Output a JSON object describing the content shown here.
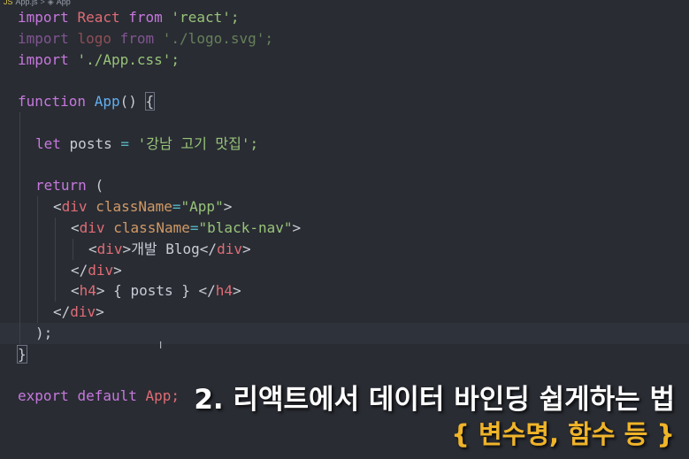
{
  "breadcrumb": {
    "file_icon": "js-file-icon",
    "file": "App.js",
    "separator": ">",
    "symbol_icon": "component-icon",
    "symbol": "App"
  },
  "code": {
    "l1": {
      "kw1": "import",
      "id": "React",
      "kw2": "from",
      "str": "'react';"
    },
    "l2": {
      "kw1": "import",
      "id": "logo",
      "kw2": "from",
      "str": "'./logo.svg';"
    },
    "l3": {
      "kw1": "import",
      "str": "'./App.css';"
    },
    "l5": {
      "kw": "function",
      "fn": "App",
      "paren": "()",
      "brace": "{"
    },
    "l7": {
      "kw": "let",
      "id": "posts",
      "op": "=",
      "str": "'강남 고기 맛집';"
    },
    "l9": {
      "kw": "return",
      "paren": "("
    },
    "l10": {
      "open": "<",
      "tag": "div",
      "attr": "className",
      "eq": "=",
      "str": "\"App\"",
      "close": ">"
    },
    "l11": {
      "open": "<",
      "tag": "div",
      "attr": "className",
      "eq": "=",
      "str": "\"black-nav\"",
      "close": ">"
    },
    "l12": {
      "open": "<",
      "tag": "div",
      "close": ">",
      "text": "개발 Blog",
      "endopen": "</",
      "endtag": "div",
      "endclose": ">"
    },
    "l13": {
      "open": "</",
      "tag": "div",
      "close": ">"
    },
    "l14": {
      "open": "<",
      "tag": "h4",
      "close": ">",
      "text": " { posts } ",
      "endopen": "</",
      "endtag": "h4",
      "endclose": ">"
    },
    "l15": {
      "open": "</",
      "tag": "div",
      "close": ">"
    },
    "l16": {
      "text": ");"
    },
    "l17": {
      "text": "}"
    },
    "l19": {
      "kw1": "export",
      "kw2": "default",
      "id": "App;"
    }
  },
  "cursor_glyph": "I",
  "caption": {
    "title": "2. 리액트에서 데이터 바인딩 쉽게하는 법",
    "subtitle": "{ 변수명, 함수 등 }"
  },
  "colors": {
    "background": "#292c33",
    "keyword": "#c678dd",
    "function": "#61afef",
    "string": "#98c379",
    "tag": "#e06c75",
    "attribute": "#d19a66",
    "caption_title": "#ffffff",
    "caption_subtitle": "#f0b429"
  }
}
